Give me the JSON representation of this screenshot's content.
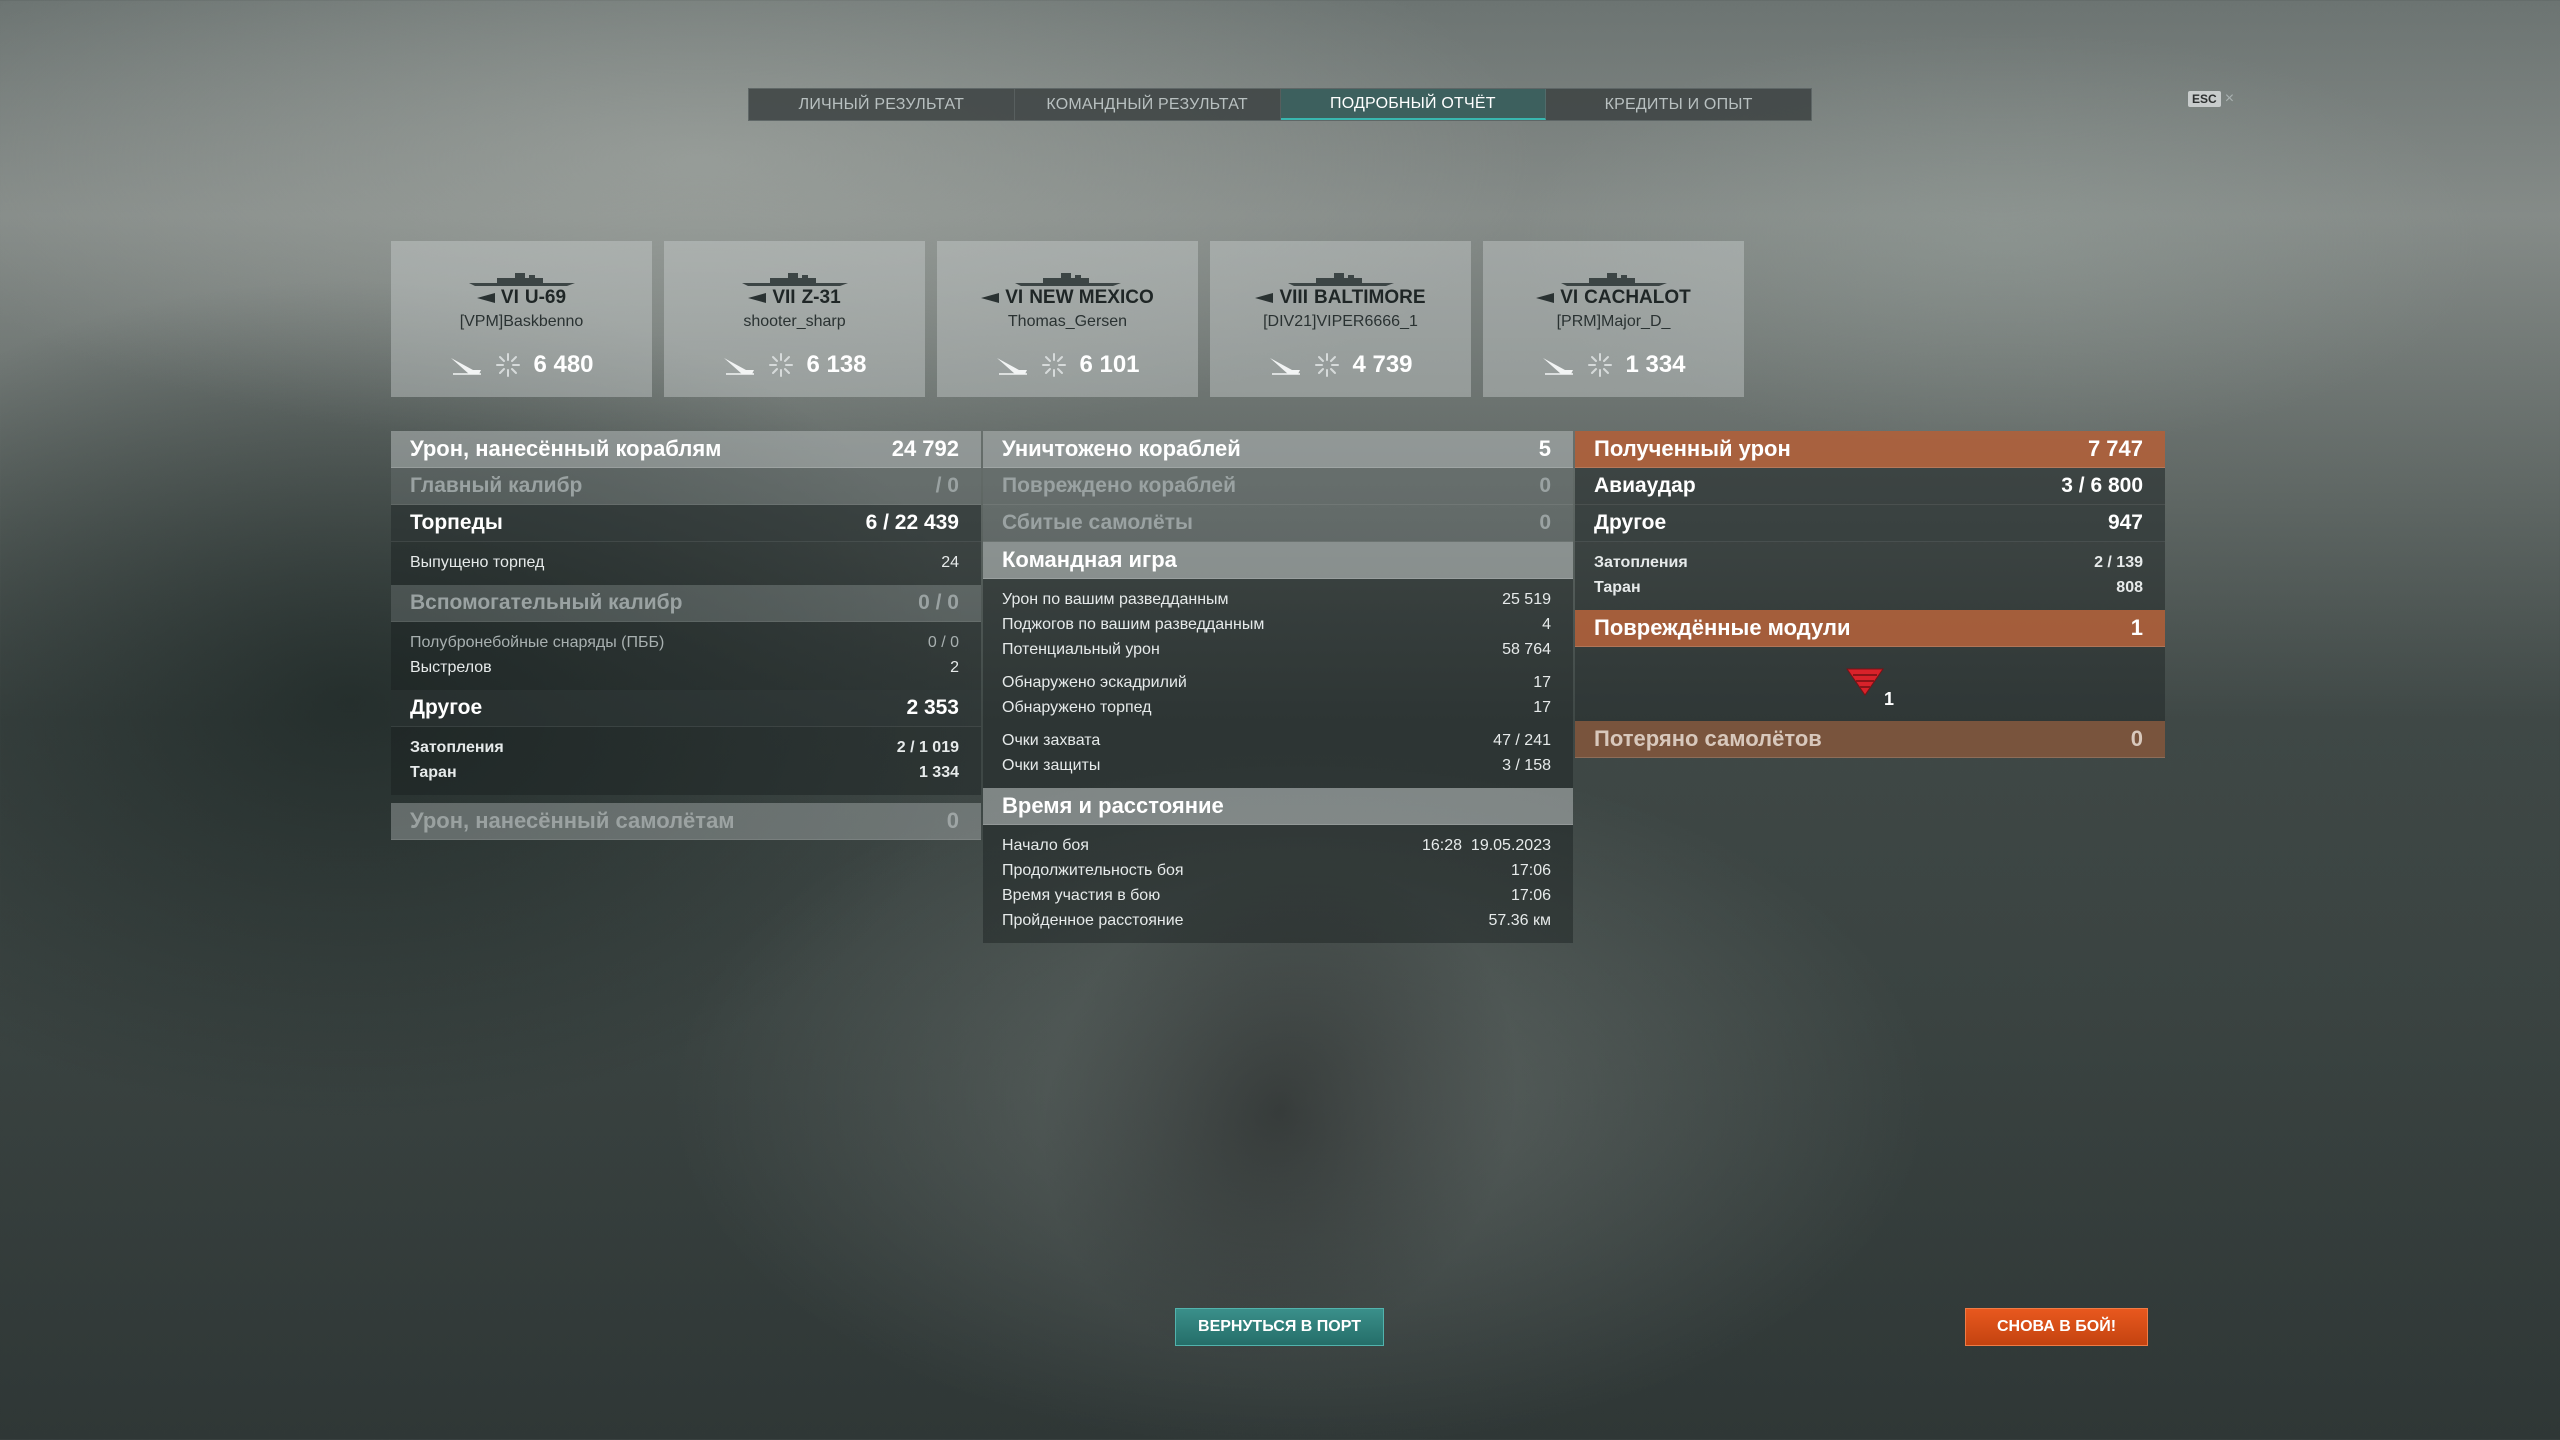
{
  "tabs": [
    {
      "label": "ЛИЧНЫЙ РЕЗУЛЬТАТ",
      "active": false
    },
    {
      "label": "КОМАНДНЫЙ РЕЗУЛЬТАТ",
      "active": false
    },
    {
      "label": "ПОДРОБНЫЙ ОТЧЁТ",
      "active": true
    },
    {
      "label": "КРЕДИТЫ И ОПЫТ",
      "active": false
    }
  ],
  "esc": {
    "key": "ESC",
    "close": "×"
  },
  "ships": [
    {
      "tier": "VI",
      "name": "U-69",
      "player": "[VPM]Baskbenno",
      "damage": "6 480"
    },
    {
      "tier": "VII",
      "name": "Z-31",
      "player": "shooter_sharp",
      "damage": "6 138"
    },
    {
      "tier": "VI",
      "name": "NEW MEXICO",
      "player": "Thomas_Gersen",
      "damage": "6 101"
    },
    {
      "tier": "VIII",
      "name": "BALTIMORE",
      "player": "[DIV21]VIPER6666_1",
      "damage": "4 739"
    },
    {
      "tier": "VI",
      "name": "CACHALOT",
      "player": "[PRM]Major_D_",
      "damage": "1 334"
    }
  ],
  "col1": {
    "ship_damage": {
      "label": "Урон, нанесённый кораблям",
      "value": "24 792"
    },
    "main_battery": {
      "label": "Главный калибр",
      "value": "/ 0"
    },
    "torpedoes": {
      "label": "Торпеды",
      "value": "6 / 22 439"
    },
    "torpedoes_fired": {
      "label": "Выпущено торпед",
      "value": "24"
    },
    "secondary": {
      "label": "Вспомогательный калибр",
      "value": "0 / 0"
    },
    "sap": {
      "label": "Полубронебойные снаряды (ПББ)",
      "value": "0 / 0"
    },
    "shots": {
      "label": "Выстрелов",
      "value": "2"
    },
    "other": {
      "label": "Другое",
      "value": "2 353"
    },
    "flooding": {
      "label": "Затопления",
      "value": "2 / 1 019"
    },
    "ram": {
      "label": "Таран",
      "value": "1 334"
    },
    "plane_damage": {
      "label": "Урон, нанесённый самолётам",
      "value": "0"
    }
  },
  "col2": {
    "destroyed": {
      "label": "Уничтожено кораблей",
      "value": "5"
    },
    "damaged": {
      "label": "Повреждено кораблей",
      "value": "0"
    },
    "planes_shot": {
      "label": "Сбитые самолёты",
      "value": "0"
    },
    "team_play": {
      "label": "Командная игра"
    },
    "spotting_damage": {
      "label": "Урон по вашим разведданным",
      "value": "25 519"
    },
    "spotting_fires": {
      "label": "Поджогов по вашим разведданным",
      "value": "4"
    },
    "potential": {
      "label": "Потенциальный урон",
      "value": "58 764"
    },
    "squadrons_spotted": {
      "label": "Обнаружено эскадрилий",
      "value": "17"
    },
    "torps_spotted": {
      "label": "Обнаружено торпед",
      "value": "17"
    },
    "capture": {
      "label": "Очки захвата",
      "value": "47 / 241"
    },
    "defense": {
      "label": "Очки защиты",
      "value": "3 / 158"
    },
    "time_distance": {
      "label": "Время и расстояние"
    },
    "battle_start": {
      "label": "Начало боя",
      "value": "16:28  19.05.2023"
    },
    "duration": {
      "label": "Продолжительность боя",
      "value": "17:06"
    },
    "participation": {
      "label": "Время участия в бою",
      "value": "17:06"
    },
    "distance": {
      "label": "Пройденное расстояние",
      "value": "57.36 км"
    }
  },
  "col3": {
    "received": {
      "label": "Полученный урон",
      "value": "7 747"
    },
    "airstrike": {
      "label": "Авиаудар",
      "value": "3 / 6 800"
    },
    "other": {
      "label": "Другое",
      "value": "947"
    },
    "flooding": {
      "label": "Затопления",
      "value": "2 / 139"
    },
    "ram": {
      "label": "Таран",
      "value": "808"
    },
    "modules": {
      "label": "Повреждённые модули",
      "value": "1"
    },
    "module_count": "1",
    "planes_lost": {
      "label": "Потеряно самолётов",
      "value": "0"
    }
  },
  "buttons": {
    "port": "ВЕРНУТЬСЯ В ПОРТ",
    "battle": "СНОВА В БОЙ!"
  },
  "colors": {
    "accent_teal": "#39b7b0",
    "orange": "#e8581e"
  }
}
